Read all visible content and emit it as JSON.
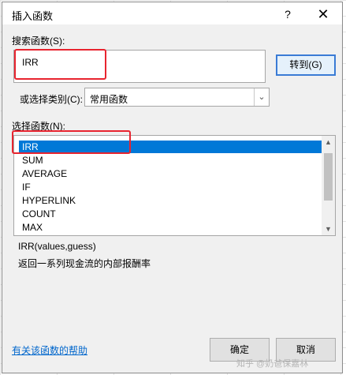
{
  "dialog": {
    "title": "插入函数",
    "help_glyph": "?",
    "close_glyph": "✕"
  },
  "search": {
    "label": "搜索函数(S):",
    "value": "IRR",
    "goto_label": "转到(G)"
  },
  "category": {
    "label": "或选择类别(C):",
    "value": "常用函数",
    "arrow_glyph": "⌄"
  },
  "function_list": {
    "label": "选择函数(N):",
    "items": [
      "IRR",
      "SUM",
      "AVERAGE",
      "IF",
      "HYPERLINK",
      "COUNT",
      "MAX"
    ],
    "selected_index": 0,
    "scroll_up_glyph": "▲",
    "scroll_down_glyph": "▼"
  },
  "description": {
    "signature": "IRR(values,guess)",
    "text": "返回一系列现金流的内部报酬率"
  },
  "footer": {
    "help_link": "有关该函数的帮助",
    "ok_label": "确定",
    "cancel_label": "取消"
  },
  "watermark": "知乎 @奶爸保嘉林",
  "colors": {
    "highlight_box": "#e8242f",
    "selection": "#0078d7",
    "link": "#0066cc"
  }
}
